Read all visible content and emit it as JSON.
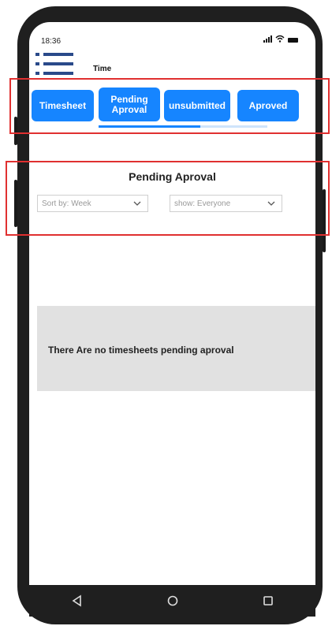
{
  "status_bar": {
    "time": "18:36"
  },
  "header": {
    "title": "Time"
  },
  "tabs": [
    {
      "label": "Timesheet"
    },
    {
      "label": "Pending Aproval"
    },
    {
      "label": "unsubmitted"
    },
    {
      "label": "Aproved"
    }
  ],
  "section": {
    "title": "Pending Aproval"
  },
  "filters": {
    "sort_label": "Sort by: Week",
    "show_label": "show: Everyone"
  },
  "empty_state": {
    "message": "There Are no timesheets pending aproval"
  },
  "colors": {
    "accent": "#1685ff",
    "menu_icon": "#2a4a8a",
    "annotation": "#e03030",
    "panel": "#e1e1e1",
    "phone_frame": "#1f1f1f"
  }
}
